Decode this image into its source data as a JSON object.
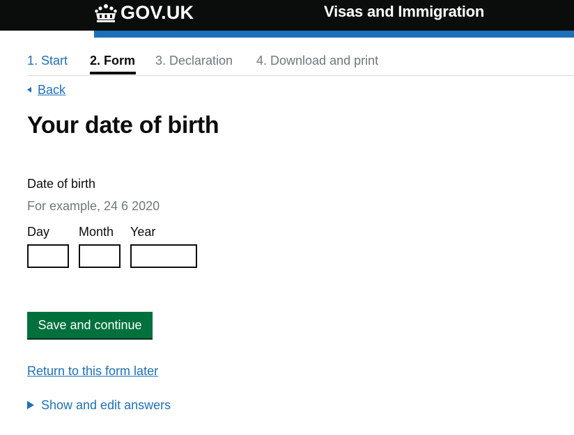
{
  "header": {
    "logo_icon": "crown-icon",
    "logo_text": "GOV.UK",
    "service_name": "Visas and Immigration",
    "background": "#0b0c0c",
    "accent": "#1d70b8"
  },
  "steps": [
    {
      "label": "1. Start",
      "state": "done"
    },
    {
      "label": "2. Form",
      "state": "current"
    },
    {
      "label": "3. Declaration",
      "state": "future"
    },
    {
      "label": "4. Download and print",
      "state": "future"
    }
  ],
  "back": {
    "icon": "triangle-left-icon",
    "label": "Back"
  },
  "page": {
    "title": "Your date of birth"
  },
  "form": {
    "legend": "Date of birth",
    "hint": "For example, 24 6 2020",
    "day": {
      "label": "Day",
      "value": ""
    },
    "month": {
      "label": "Month",
      "value": ""
    },
    "year": {
      "label": "Year",
      "value": ""
    },
    "submit_label": "Save and continue",
    "submit_color": "#00703c"
  },
  "links": {
    "return_later": "Return to this form later",
    "show_edit": "Show and edit answers",
    "show_edit_icon": "triangle-right-icon"
  }
}
